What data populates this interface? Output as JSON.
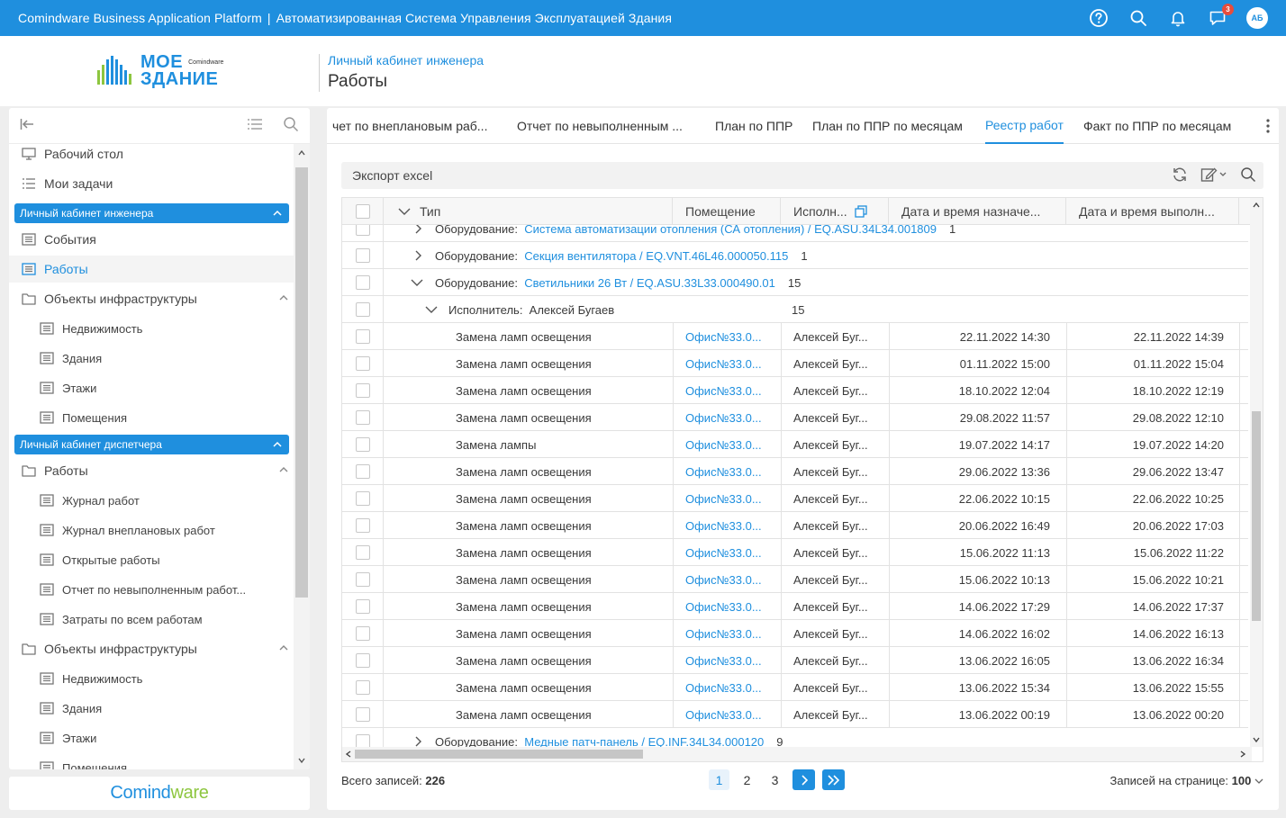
{
  "topbar": {
    "product": "Comindware Business Application Platform",
    "separator": "|",
    "system_name": "Автоматизированная Система Управления Эксплуатацией Здания",
    "notifications_count": "3",
    "avatar_initials": "АБ",
    "bg_color": "#1f8fde"
  },
  "logo": {
    "line1": "МОЕ",
    "line1_small": "Comindware",
    "line2": "ЗДАНИЕ"
  },
  "header": {
    "breadcrumb": "Личный кабинет инженера",
    "title": "Работы"
  },
  "sidebar": {
    "items": [
      {
        "label": "Рабочий стол",
        "icon": "desktop-icon"
      },
      {
        "label": "Мои задачи",
        "icon": "tasks-icon"
      },
      {
        "label": "Личный кабинет инженера",
        "section": true
      },
      {
        "label": "События",
        "icon": "list-icon"
      },
      {
        "label": "Работы",
        "icon": "list-icon",
        "active": true
      },
      {
        "label": "Объекты инфраструктуры",
        "icon": "folder-icon",
        "expanded": true
      },
      {
        "label": "Недвижимость",
        "icon": "list-icon",
        "sub": true
      },
      {
        "label": "Здания",
        "icon": "list-icon",
        "sub": true
      },
      {
        "label": "Этажи",
        "icon": "list-icon",
        "sub": true
      },
      {
        "label": "Помещения",
        "icon": "list-icon",
        "sub": true
      },
      {
        "label": "Личный кабинет диспетчера",
        "section": true
      },
      {
        "label": "Работы",
        "icon": "folder-icon",
        "expanded": true
      },
      {
        "label": "Журнал работ",
        "icon": "list-icon",
        "sub": true
      },
      {
        "label": "Журнал внеплановых работ",
        "icon": "list-icon",
        "sub": true
      },
      {
        "label": "Открытые работы",
        "icon": "list-icon",
        "sub": true
      },
      {
        "label": "Отчет по невыполненным работ...",
        "icon": "list-icon",
        "sub": true
      },
      {
        "label": "Затраты по всем работам",
        "icon": "list-icon",
        "sub": true
      },
      {
        "label": "Объекты инфраструктуры",
        "icon": "folder-icon",
        "expanded": true
      },
      {
        "label": "Недвижимость",
        "icon": "list-icon",
        "sub": true
      },
      {
        "label": "Здания",
        "icon": "list-icon",
        "sub": true
      },
      {
        "label": "Этажи",
        "icon": "list-icon",
        "sub": true
      },
      {
        "label": "Помещения",
        "icon": "list-icon",
        "sub": true
      }
    ],
    "brand": {
      "part1": "Comind",
      "part2": "ware"
    }
  },
  "tabs": [
    {
      "label": "чет по внеплановым раб..."
    },
    {
      "label": "Отчет по невыполненным ..."
    },
    {
      "label": "План по ППР"
    },
    {
      "label": "План по ППР по месяцам"
    },
    {
      "label": "Реестр работ",
      "active": true
    },
    {
      "label": "Факт по ППР по месяцам"
    }
  ],
  "export": {
    "label": "Экспорт excel"
  },
  "grid": {
    "columns": [
      "Тип",
      "Помещение",
      "Исполн...",
      "Дата и время назначе...",
      "Дата и время выполн..."
    ],
    "groups": [
      {
        "prefix": "Оборудование:",
        "link": "Система автоматизации отопления (СА отопления) / EQ.ASU.34L34.001809",
        "count": "1",
        "expanded": false
      },
      {
        "prefix": "Оборудование:",
        "link": "Секция вентилятора / EQ.VNT.46L46.000050.115",
        "count": "1",
        "expanded": false
      },
      {
        "prefix": "Оборудование:",
        "link": "Светильники 26 Вт / EQ.ASU.33L33.000490.01",
        "count": "15",
        "expanded": true
      }
    ],
    "subgroup": {
      "prefix": "Исполнитель:",
      "value": "Алексей Бугаев",
      "count": "15"
    },
    "rows": [
      {
        "type": "Замена ламп освещения",
        "room": "Офис№33.0...",
        "executor": "Алексей Буг...",
        "assigned": "22.11.2022 14:30",
        "done": "22.11.2022 14:39"
      },
      {
        "type": "Замена ламп освещения",
        "room": "Офис№33.0...",
        "executor": "Алексей Буг...",
        "assigned": "01.11.2022 15:00",
        "done": "01.11.2022 15:04"
      },
      {
        "type": "Замена ламп освещения",
        "room": "Офис№33.0...",
        "executor": "Алексей Буг...",
        "assigned": "18.10.2022 12:04",
        "done": "18.10.2022 12:19"
      },
      {
        "type": "Замена ламп освещения",
        "room": "Офис№33.0...",
        "executor": "Алексей Буг...",
        "assigned": "29.08.2022 11:57",
        "done": "29.08.2022 12:10"
      },
      {
        "type": "Замена лампы",
        "room": "Офис№33.0...",
        "executor": "Алексей Буг...",
        "assigned": "19.07.2022 14:17",
        "done": "19.07.2022 14:20"
      },
      {
        "type": "Замена ламп освещения",
        "room": "Офис№33.0...",
        "executor": "Алексей Буг...",
        "assigned": "29.06.2022 13:36",
        "done": "29.06.2022 13:47"
      },
      {
        "type": "Замена ламп освещения",
        "room": "Офис№33.0...",
        "executor": "Алексей Буг...",
        "assigned": "22.06.2022 10:15",
        "done": "22.06.2022 10:25"
      },
      {
        "type": "Замена ламп освещения",
        "room": "Офис№33.0...",
        "executor": "Алексей Буг...",
        "assigned": "20.06.2022 16:49",
        "done": "20.06.2022 17:03"
      },
      {
        "type": "Замена ламп освещения",
        "room": "Офис№33.0...",
        "executor": "Алексей Буг...",
        "assigned": "15.06.2022 11:13",
        "done": "15.06.2022 11:22"
      },
      {
        "type": "Замена ламп освещения",
        "room": "Офис№33.0...",
        "executor": "Алексей Буг...",
        "assigned": "15.06.2022 10:13",
        "done": "15.06.2022 10:21"
      },
      {
        "type": "Замена ламп освещения",
        "room": "Офис№33.0...",
        "executor": "Алексей Буг...",
        "assigned": "14.06.2022 17:29",
        "done": "14.06.2022 17:37"
      },
      {
        "type": "Замена ламп освещения",
        "room": "Офис№33.0...",
        "executor": "Алексей Буг...",
        "assigned": "14.06.2022 16:02",
        "done": "14.06.2022 16:13"
      },
      {
        "type": "Замена ламп освещения",
        "room": "Офис№33.0...",
        "executor": "Алексей Буг...",
        "assigned": "13.06.2022 16:05",
        "done": "13.06.2022 16:34"
      },
      {
        "type": "Замена ламп освещения",
        "room": "Офис№33.0...",
        "executor": "Алексей Буг...",
        "assigned": "13.06.2022 15:34",
        "done": "13.06.2022 15:55"
      },
      {
        "type": "Замена ламп освещения",
        "room": "Офис№33.0...",
        "executor": "Алексей Буг...",
        "assigned": "13.06.2022 00:19",
        "done": "13.06.2022 00:20"
      }
    ],
    "last_group": {
      "prefix": "Оборудование:",
      "link": "Медные патч-панель / EQ.INF.34L34.000120",
      "count": "9"
    }
  },
  "footer": {
    "total_label": "Всего записей:",
    "total_value": "226",
    "pages": [
      "1",
      "2",
      "3"
    ],
    "current_page": "1",
    "next": "›",
    "last": "»",
    "per_page_label": "Записей на странице:",
    "per_page_value": "100"
  }
}
